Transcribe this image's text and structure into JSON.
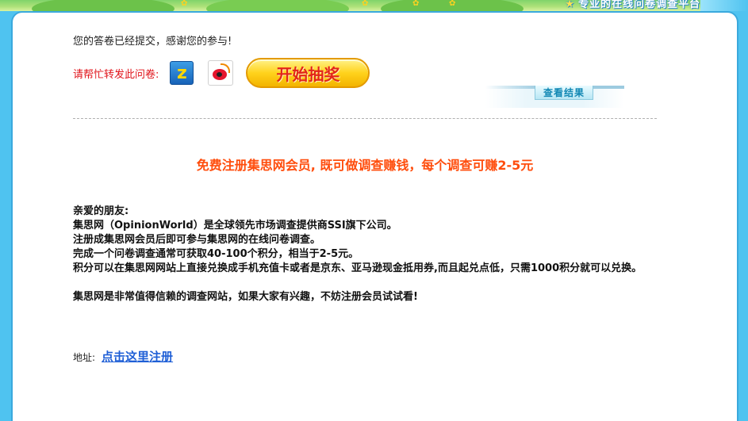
{
  "header": {
    "slogan": "专业的在线问卷调查平台"
  },
  "status": {
    "thanks_message": "您的答卷已经提交，感谢您的参与!"
  },
  "share": {
    "label": "请帮忙转发此问卷:",
    "qzone_glyph": "z",
    "draw_button_label": "开始抽奖"
  },
  "results": {
    "view_label": "查看结果"
  },
  "promo": {
    "headline": "免费注册集思网会员, 既可做调查赚钱，每个调查可赚2-5元"
  },
  "body": {
    "lines": [
      "亲爱的朋友:",
      "集思网（OpinionWorld）是全球领先市场调查提供商SSI旗下公司。",
      "注册成集思网会员后即可参与集思网的在线问卷调查。",
      "完成一个问卷调查通常可获取40-100个积分，相当于2-5元。",
      "积分可以在集思网网站上直接兑换成手机充值卡或者是京东、亚马逊现金抵用券,而且起兑点低，只需1000积分就可以兑换。"
    ],
    "closing": "集思网是非常值得信赖的调查网站，如果大家有兴趣，不妨注册会员试试看!"
  },
  "address": {
    "label": "地址:",
    "link_text": "点击这里注册"
  },
  "colors": {
    "frame_blue": "#4fc3f0",
    "share_label_red": "#e0131a",
    "promo_orange": "#ff4d0d",
    "link_blue": "#1f5fd6",
    "button_yellow": "#ffd21c"
  }
}
